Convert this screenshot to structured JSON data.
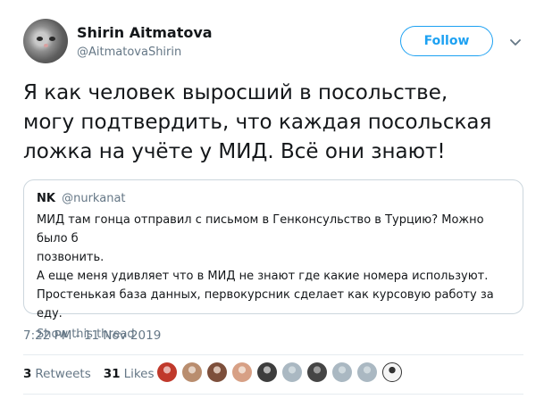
{
  "author": {
    "name": "Shirin Aitmatova",
    "handle": "@AitmatovaShirin",
    "avatar_icon": "cat-avatar"
  },
  "follow_label": "Follow",
  "menu_icon": "chevron-down-icon",
  "tweet_lines": [
    "Я как человек выросший в посольстве,",
    "могу подтвердить, что каждая посольская",
    "ложка на учёте у МИД. Всё они знают!"
  ],
  "quote": {
    "name": "NK",
    "handle": "@nurkanat",
    "lines": [
      "МИД там гонца отправил с письмом в Генконсульство в Турцию? Можно было б",
      "позвонить.",
      "А еще меня удивляет что в МИД не знают где какие номера используют.",
      "Простенькая база данных, первокурсник сделает как курсовую работу за еду."
    ],
    "show_thread": "Show this thread"
  },
  "timestamp": "7:22 PM - 11 Nov 2019",
  "stats": {
    "retweets_count": "3",
    "retweets_label": "Retweets",
    "likes_count": "31",
    "likes_label": "Likes"
  },
  "likers": [
    {
      "color": "#c0392b",
      "ring": "#e8b4ae"
    },
    {
      "color": "#b98d6e",
      "ring": "#e5d2c4"
    },
    {
      "color": "#7d4f3b",
      "ring": "#d8c0b2"
    },
    {
      "color": "#d7a085",
      "ring": "#f0dccf"
    },
    {
      "color": "#3d3d3d",
      "ring": "#b5b5b5"
    },
    {
      "color": "#aab8c2",
      "ring": "#cfd9de"
    },
    {
      "color": "#454545",
      "ring": "#9c9c9c"
    },
    {
      "color": "#aab8c2",
      "ring": "#cfd9de"
    },
    {
      "color": "#aab8c2",
      "ring": "#cfd9de"
    },
    {
      "color": "#f5f5f5",
      "ring": "#333333"
    }
  ],
  "colors": {
    "accent": "#1da1f2",
    "secondary_text": "#657786",
    "border": "#ccd6dd"
  }
}
